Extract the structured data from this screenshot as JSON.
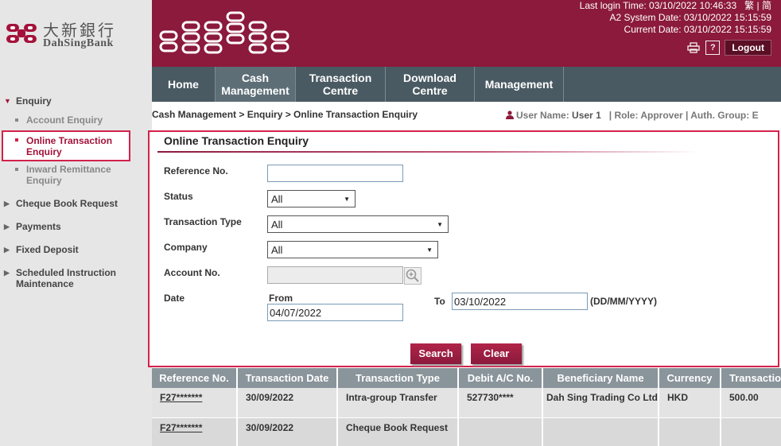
{
  "brand": {
    "name_cn": "大新銀行",
    "name_en": "DahSingBank"
  },
  "header": {
    "last_login": "Last login Time: 03/10/2022 10:46:33",
    "lang_trad": "繁",
    "lang_sep": "|",
    "lang_simp": "简",
    "a2_date": "A2 System Date: 03/10/2022 15:15:59",
    "current_date": "Current Date: 03/10/2022 15:15:59",
    "help_label": "?",
    "logout_label": "Logout"
  },
  "menu": {
    "items": [
      {
        "label": "Home"
      },
      {
        "label": "Cash\nManagement"
      },
      {
        "label": "Transaction\nCentre"
      },
      {
        "label": "Download\nCentre"
      },
      {
        "label": "Management"
      }
    ]
  },
  "sidebar": {
    "enquiry": "Enquiry",
    "account_enquiry": "Account Enquiry",
    "online_txn_enquiry": "Online Transaction Enquiry",
    "inward_remittance": "Inward Remittance Enquiry",
    "cheque_book": "Cheque Book Request",
    "payments": "Payments",
    "fixed_deposit": "Fixed Deposit",
    "scheduled": "Scheduled Instruction Maintenance"
  },
  "breadcrumb": "Cash Management > Enquiry > Online Transaction Enquiry",
  "userbar": {
    "user_label": "User Name:",
    "user_value": "User 1",
    "role": "| Role: Approver | Auth. Group: E"
  },
  "form": {
    "title": "Online Transaction Enquiry",
    "reference_label": "Reference No.",
    "reference_value": "",
    "status_label": "Status",
    "status_value": "All",
    "txn_type_label": "Transaction Type",
    "txn_type_value": "All",
    "company_label": "Company",
    "company_value": "All",
    "account_label": "Account No.",
    "account_value": "",
    "date_label": "Date",
    "from_label": "From",
    "from_value": "04/07/2022",
    "to_label": "To",
    "to_value": "03/10/2022",
    "date_format": "(DD/MM/YYYY)",
    "search_label": "Search",
    "clear_label": "Clear"
  },
  "table": {
    "headers": [
      "Reference No.",
      "Transaction Date",
      "Transaction Type",
      "Debit A/C No.",
      "Beneficiary Name",
      "Currency",
      "Transactio"
    ],
    "rows": [
      [
        "F27*******",
        "30/09/2022",
        "Intra-group Transfer",
        "527730****",
        "Dah Sing Trading Co Ltd",
        "HKD",
        "500.00"
      ],
      [
        "F27*******",
        "30/09/2022",
        "Cheque Book Request",
        "",
        "",
        "",
        ""
      ]
    ]
  },
  "colors": {
    "brand": "#8b1a3c",
    "menubar": "#4a5a63",
    "highlight": "#d4214a",
    "table_header": "#8a949b"
  }
}
